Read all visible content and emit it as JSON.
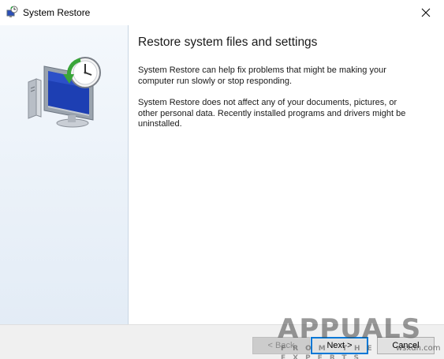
{
  "window": {
    "title": "System Restore",
    "close_icon": "close-icon",
    "title_icon": "system-restore-icon"
  },
  "side_panel": {
    "illustration": "computer-restore-clock-icon"
  },
  "content": {
    "heading": "Restore system files and settings",
    "paragraph_1": "System Restore can help fix problems that might be making your computer run slowly or stop responding.",
    "paragraph_2": "System Restore does not affect any of your documents, pictures, or other personal data. Recently installed programs and drivers might be uninstalled."
  },
  "footer": {
    "back_label": "< Back",
    "next_label": "Next >",
    "cancel_label": "Cancel"
  },
  "watermark": {
    "main": "APPUALS",
    "sub": "FROM THE EXPERTS",
    "brand": "wsxdn.com"
  },
  "colors": {
    "accent": "#0078d7",
    "side_panel_top": "#f4f8fc",
    "side_panel_bottom": "#e3ecf6",
    "footer_bg": "#f0f0f0"
  }
}
